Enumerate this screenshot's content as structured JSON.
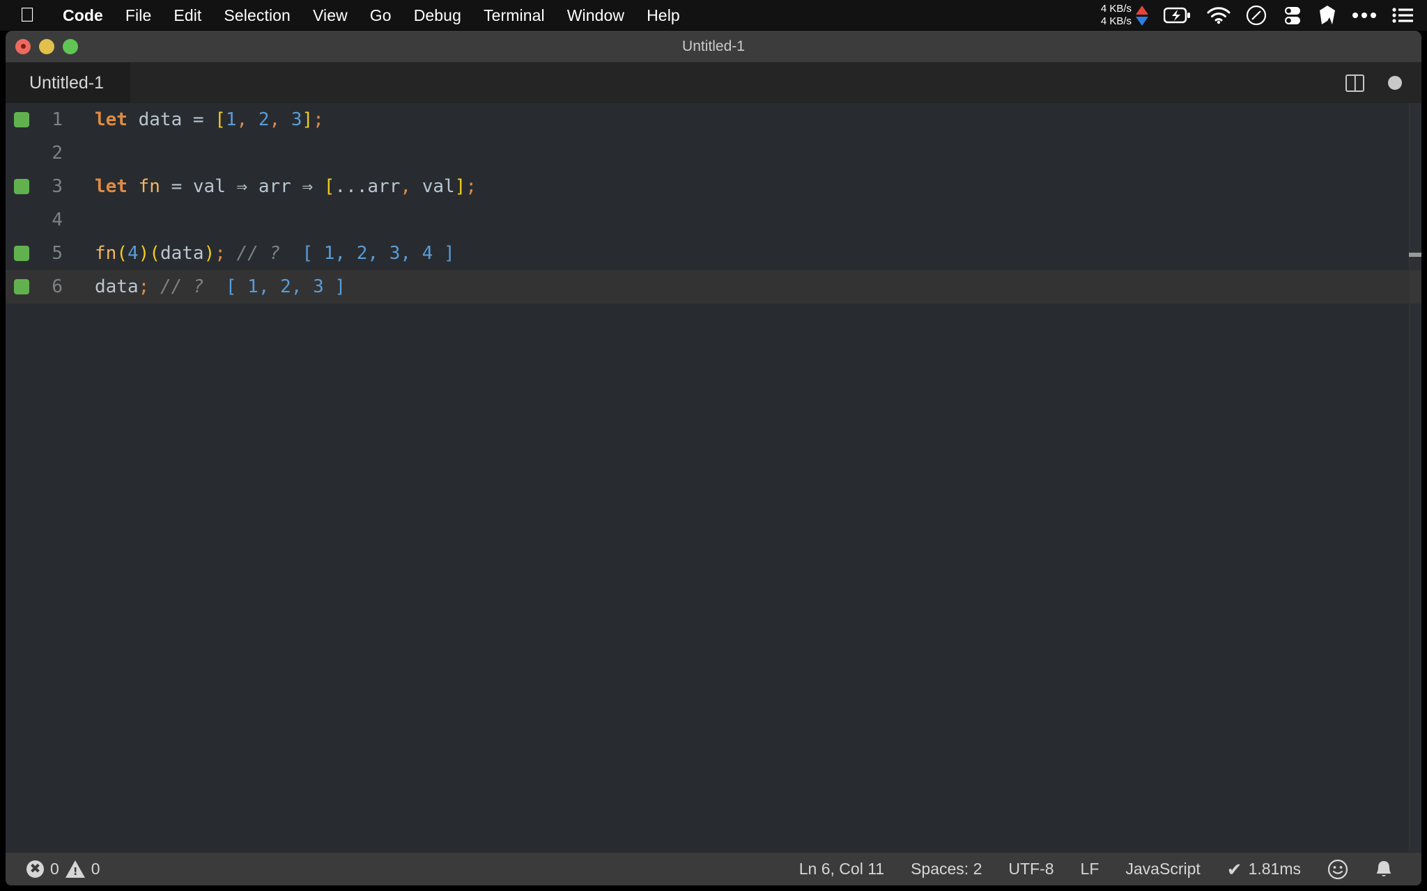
{
  "menubar": {
    "apple_logo": "apple-logo",
    "items": [
      {
        "label": "Code",
        "bold": true
      },
      {
        "label": "File",
        "bold": false
      },
      {
        "label": "Edit",
        "bold": false
      },
      {
        "label": "Selection",
        "bold": false
      },
      {
        "label": "View",
        "bold": false
      },
      {
        "label": "Go",
        "bold": false
      },
      {
        "label": "Debug",
        "bold": false
      },
      {
        "label": "Terminal",
        "bold": false
      },
      {
        "label": "Window",
        "bold": false
      },
      {
        "label": "Help",
        "bold": false
      }
    ],
    "status": {
      "net_up": "4 KB/s",
      "net_down": "4 KB/s",
      "icons": [
        "battery-charging-icon",
        "wifi-icon",
        "dnd-icon",
        "toggles-icon",
        "gem-icon",
        "ellipsis-icon",
        "list-menu-icon"
      ],
      "battery_glyph": "⚡",
      "wifi_glyph": "◗",
      "dnd_glyph": "⊘",
      "toggles_glyph": "⬭",
      "gem_glyph": "◣",
      "ellipsis_glyph": "•••",
      "list_glyph": "☰"
    }
  },
  "window": {
    "title": "Untitled-1",
    "traffic_lights": [
      "close",
      "minimize",
      "maximize"
    ]
  },
  "tabs": {
    "active": "Untitled-1",
    "actions": {
      "split_editor": "split-editor-icon",
      "unsaved_indicator": "unsaved-dot-icon"
    }
  },
  "editor": {
    "language_mode": "JavaScript",
    "lines": [
      {
        "num": "1",
        "marker": true,
        "current": false,
        "tokens": [
          {
            "t": "let",
            "c": "t-kw"
          },
          {
            "t": " ",
            "c": "t-op"
          },
          {
            "t": "data",
            "c": "t-var"
          },
          {
            "t": " ",
            "c": "t-op"
          },
          {
            "t": "=",
            "c": "t-op"
          },
          {
            "t": " ",
            "c": "t-op"
          },
          {
            "t": "[",
            "c": "t-brk"
          },
          {
            "t": "1",
            "c": "t-num"
          },
          {
            "t": ",",
            "c": "t-pun"
          },
          {
            "t": " ",
            "c": "t-op"
          },
          {
            "t": "2",
            "c": "t-num"
          },
          {
            "t": ",",
            "c": "t-pun"
          },
          {
            "t": " ",
            "c": "t-op"
          },
          {
            "t": "3",
            "c": "t-num"
          },
          {
            "t": "]",
            "c": "t-brk"
          },
          {
            "t": ";",
            "c": "t-pun"
          }
        ]
      },
      {
        "num": "2",
        "marker": false,
        "current": false,
        "tokens": []
      },
      {
        "num": "3",
        "marker": true,
        "current": false,
        "tokens": [
          {
            "t": "let",
            "c": "t-kw"
          },
          {
            "t": " ",
            "c": "t-op"
          },
          {
            "t": "fn",
            "c": "t-fn"
          },
          {
            "t": " ",
            "c": "t-op"
          },
          {
            "t": "=",
            "c": "t-op"
          },
          {
            "t": " ",
            "c": "t-op"
          },
          {
            "t": "val",
            "c": "t-var"
          },
          {
            "t": " ",
            "c": "t-op"
          },
          {
            "t": "⇒",
            "c": "t-arrow"
          },
          {
            "t": " ",
            "c": "t-op"
          },
          {
            "t": "arr",
            "c": "t-var"
          },
          {
            "t": " ",
            "c": "t-op"
          },
          {
            "t": "⇒",
            "c": "t-arrow"
          },
          {
            "t": " ",
            "c": "t-op"
          },
          {
            "t": "[",
            "c": "t-brk"
          },
          {
            "t": "...",
            "c": "t-spread"
          },
          {
            "t": "arr",
            "c": "t-var"
          },
          {
            "t": ",",
            "c": "t-pun"
          },
          {
            "t": " ",
            "c": "t-op"
          },
          {
            "t": "val",
            "c": "t-var"
          },
          {
            "t": "]",
            "c": "t-brk"
          },
          {
            "t": ";",
            "c": "t-pun"
          }
        ]
      },
      {
        "num": "4",
        "marker": false,
        "current": false,
        "tokens": []
      },
      {
        "num": "5",
        "marker": true,
        "current": false,
        "tokens": [
          {
            "t": "fn",
            "c": "t-fn"
          },
          {
            "t": "(",
            "c": "t-brk"
          },
          {
            "t": "4",
            "c": "t-num"
          },
          {
            "t": ")",
            "c": "t-brk"
          },
          {
            "t": "(",
            "c": "t-brk"
          },
          {
            "t": "data",
            "c": "t-var"
          },
          {
            "t": ")",
            "c": "t-brk"
          },
          {
            "t": ";",
            "c": "t-pun"
          },
          {
            "t": " ",
            "c": "t-op"
          },
          {
            "t": "// ?",
            "c": "t-cmt"
          },
          {
            "t": "  ",
            "c": "t-op"
          },
          {
            "t": "[ 1, 2, 3, 4 ]",
            "c": "t-res"
          }
        ]
      },
      {
        "num": "6",
        "marker": true,
        "current": true,
        "tokens": [
          {
            "t": "data",
            "c": "t-var"
          },
          {
            "t": ";",
            "c": "t-pun"
          },
          {
            "t": " ",
            "c": "t-op"
          },
          {
            "t": "// ?",
            "c": "t-cmt"
          },
          {
            "t": "  ",
            "c": "t-op"
          },
          {
            "t": "[ 1, 2, 3 ]",
            "c": "t-res"
          }
        ]
      }
    ],
    "raw_source": [
      "let data = [1, 2, 3];",
      "",
      "let fn = val => arr => [...arr, val];",
      "",
      "fn(4)(data); // ?  [ 1, 2, 3, 4 ]",
      "data; // ?  [ 1, 2, 3 ]"
    ]
  },
  "statusbar": {
    "errors_count": "0",
    "warnings_count": "0",
    "cursor_position": "Ln 6, Col 11",
    "indentation": "Spaces: 2",
    "encoding": "UTF-8",
    "eol": "LF",
    "language": "JavaScript",
    "runtime_check": "✔",
    "runtime_time": "1.81ms",
    "feedback_icon": "smiley-icon",
    "notifications_icon": "bell-icon",
    "feedback_glyph": "☺",
    "bell_glyph": "🔔"
  },
  "colors": {
    "menubar_bg": "#121212",
    "titlebar_bg": "#3c3c3c",
    "tabbar_bg": "#252526",
    "editor_bg": "#282c30",
    "current_line_bg": "#333333",
    "statusbar_bg": "#3b3b3b",
    "keyword": "#e08b45",
    "number": "#5a9bd5",
    "bracket": "#f2cb1d",
    "comment": "#7d8285",
    "marker_green": "#61b24f"
  }
}
